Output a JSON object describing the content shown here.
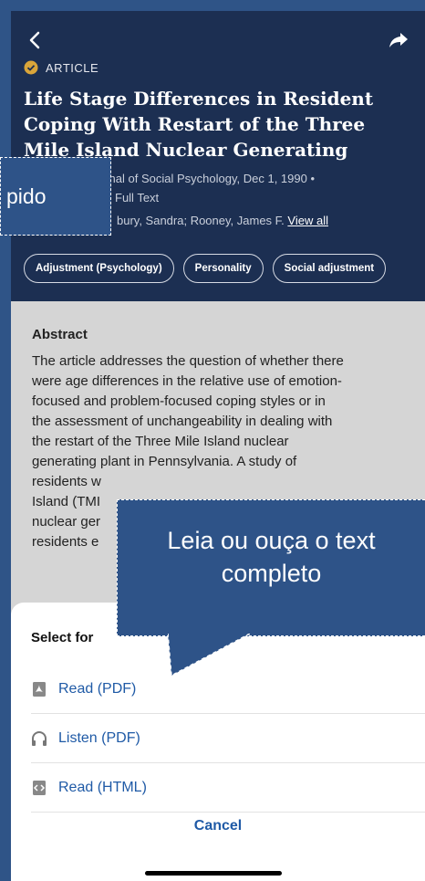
{
  "article": {
    "type_label": "ARTICLE",
    "title": "Life Stage Differences in Resident Coping With Restart of the Three Mile Island Nuclear Generating Facility.",
    "source_line": "urnal of Social Psychology, Dec 1, 1990 •",
    "fulltext_line": "Full Text",
    "authors": "bury, Sandra; Rooney, James F.",
    "view_all": "View all",
    "subjects": [
      "Adjustment (Psychology)",
      "Personality",
      "Social adjustment"
    ]
  },
  "abstract": {
    "heading": "Abstract",
    "line1": "The article addresses the question of whether there",
    "line2": "were age differences in the relative use of emotion-",
    "line3": "focused and problem-focused coping styles or in",
    "line4": "the assessment of unchangeability in dealing with",
    "line5": "the restart of the Three Mile Island nuclear",
    "line6": "generating plant in Pennsylvania. A study of",
    "line7": "residents w",
    "line8": "Island (TMI",
    "line9": "nuclear ger",
    "line10": "residents e"
  },
  "sheet": {
    "title": "Select for",
    "options": [
      {
        "label": "Read (PDF)",
        "icon": "pdf-icon"
      },
      {
        "label": "Listen (PDF)",
        "icon": "headphones-icon"
      },
      {
        "label": "Read (HTML)",
        "icon": "html-icon"
      }
    ],
    "cancel": "Cancel"
  },
  "callouts": {
    "left": "pido",
    "main": "Leia ou ouça o text completo"
  },
  "colors": {
    "header_bg": "#1c2f52",
    "accent_link": "#1f5aa6",
    "callout_bg": "#2e5388",
    "badge": "#d9a53a"
  }
}
